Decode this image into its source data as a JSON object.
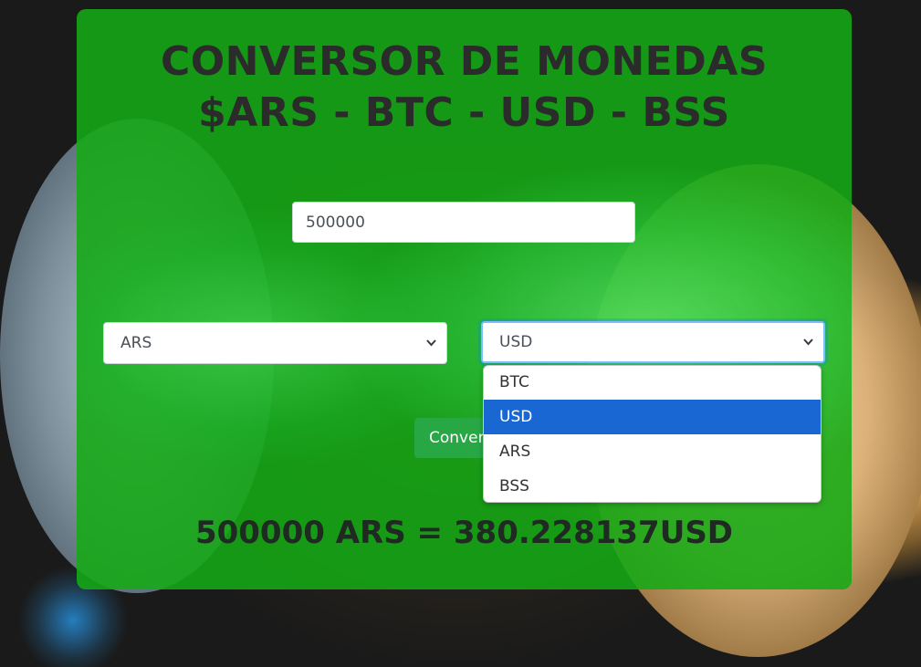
{
  "page": {
    "title_line1": "CONVERSOR DE MONEDAS",
    "title_line2": "$ARS - BTC - USD - BSS"
  },
  "form": {
    "amount_value": "500000",
    "from_currency": "ARS",
    "to_currency": "USD",
    "convert_label": "Convertir"
  },
  "dropdown": {
    "options": [
      "BTC",
      "USD",
      "ARS",
      "BSS"
    ],
    "selected": "USD"
  },
  "result": {
    "text": "500000 ARS = 380.228137USD"
  },
  "colors": {
    "card_green": "#14aa14",
    "button_green": "#28a745",
    "selection_blue": "#1967d2"
  },
  "icons": {
    "select_arrow": "chevron-down-icon"
  }
}
